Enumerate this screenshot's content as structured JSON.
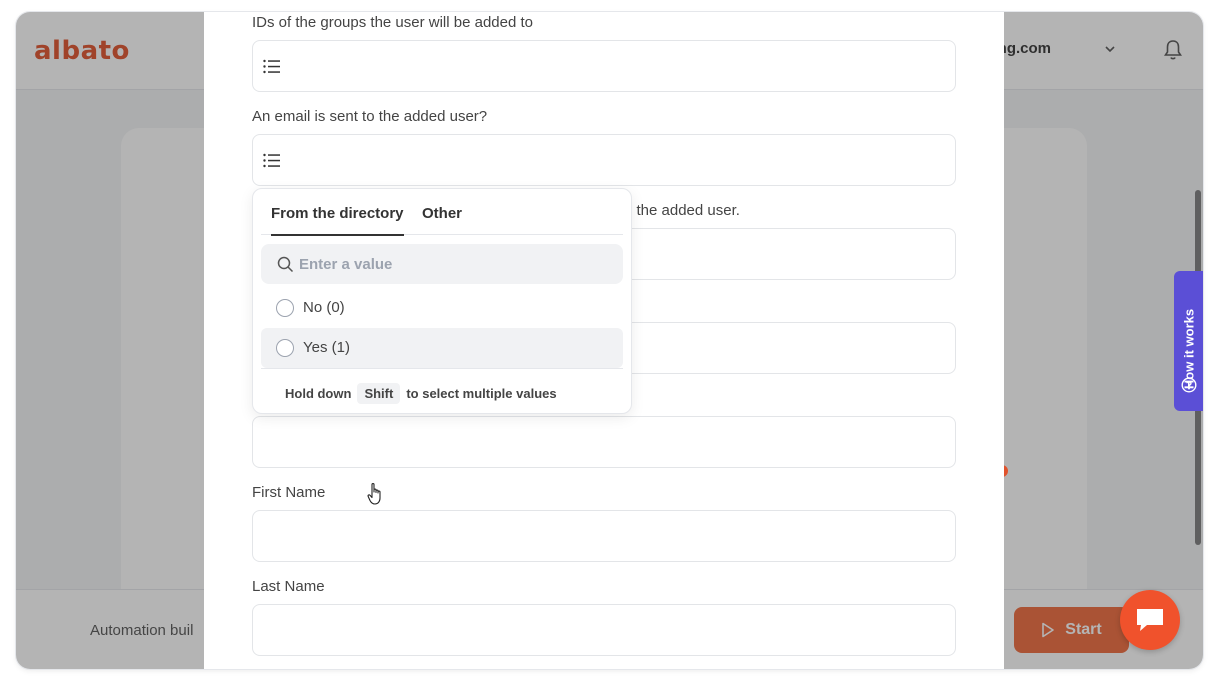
{
  "app": {
    "logo_text": "albato",
    "account_label": "spring.com",
    "bottom_text": "Automation buil",
    "start_label": "Start",
    "how_it_works_label": "How it works",
    "colors": {
      "brand": "#e0522c",
      "accent_purple": "#5b4fd6"
    }
  },
  "form": {
    "fields": [
      {
        "label": "IDs of the groups the user will be added to",
        "value": ""
      },
      {
        "label": "An email is sent to the added user?",
        "value": ""
      },
      {
        "label_visible_fragment": "o the added user.",
        "value": ""
      },
      {
        "label": "First Name",
        "value": ""
      },
      {
        "label": "Last Name",
        "value": ""
      }
    ]
  },
  "dropdown": {
    "tabs": [
      {
        "label": "From the directory",
        "active": true
      },
      {
        "label": "Other",
        "active": false
      }
    ],
    "search_placeholder": "Enter a value",
    "options": [
      {
        "label": "No (0)",
        "selected": false
      },
      {
        "label": "Yes (1)",
        "selected": false
      }
    ],
    "hint": {
      "prefix": "Hold down",
      "key": "Shift",
      "suffix": "to select multiple values"
    }
  },
  "icons": [
    "list-icon",
    "search-icon",
    "chevron-down-icon",
    "bell-icon",
    "question-icon",
    "play-icon",
    "chat-icon"
  ]
}
